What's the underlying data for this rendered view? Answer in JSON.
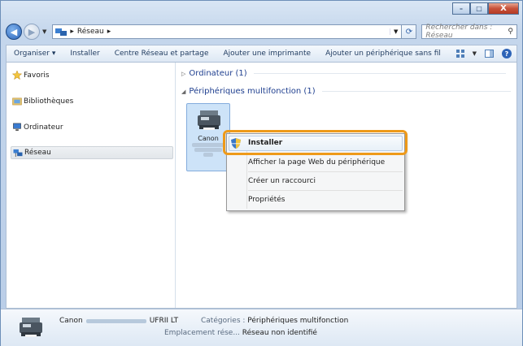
{
  "window": {
    "buttons": {
      "minimize": "–",
      "maximize": "□",
      "close": "X"
    }
  },
  "address": {
    "path_sep": "▸",
    "location": "Réseau",
    "search_placeholder": "Rechercher dans : Réseau"
  },
  "toolbar": {
    "organize": "Organiser ▾",
    "install": "Installer",
    "network_center": "Centre Réseau et partage",
    "add_printer": "Ajouter une imprimante",
    "add_wireless": "Ajouter un périphérique sans fil"
  },
  "sidebar": {
    "items": [
      {
        "label": "Favoris",
        "icon": "star-icon"
      },
      {
        "label": "Bibliothèques",
        "icon": "library-icon"
      },
      {
        "label": "Ordinateur",
        "icon": "computer-icon"
      },
      {
        "label": "Réseau",
        "icon": "network-icon"
      }
    ]
  },
  "content": {
    "group_computer": "Ordinateur (1)",
    "group_multifunction": "Périphériques multifonction (1)",
    "device_name": "Canon"
  },
  "context_menu": {
    "items": [
      "Installer",
      "Afficher la page Web du périphérique",
      "Créer un raccourci",
      "Propriétés"
    ]
  },
  "details": {
    "device_prefix": "Canon",
    "device_suffix": "UFRII LT",
    "categories_label": "Catégories :",
    "categories_value": "Périphériques multifonction",
    "location_label": "Emplacement rése...",
    "location_value": "Réseau non identifié"
  },
  "colors": {
    "highlight_border": "#ee9a1a",
    "selection": "#cde3f8",
    "group_header": "#1f3f8f"
  }
}
